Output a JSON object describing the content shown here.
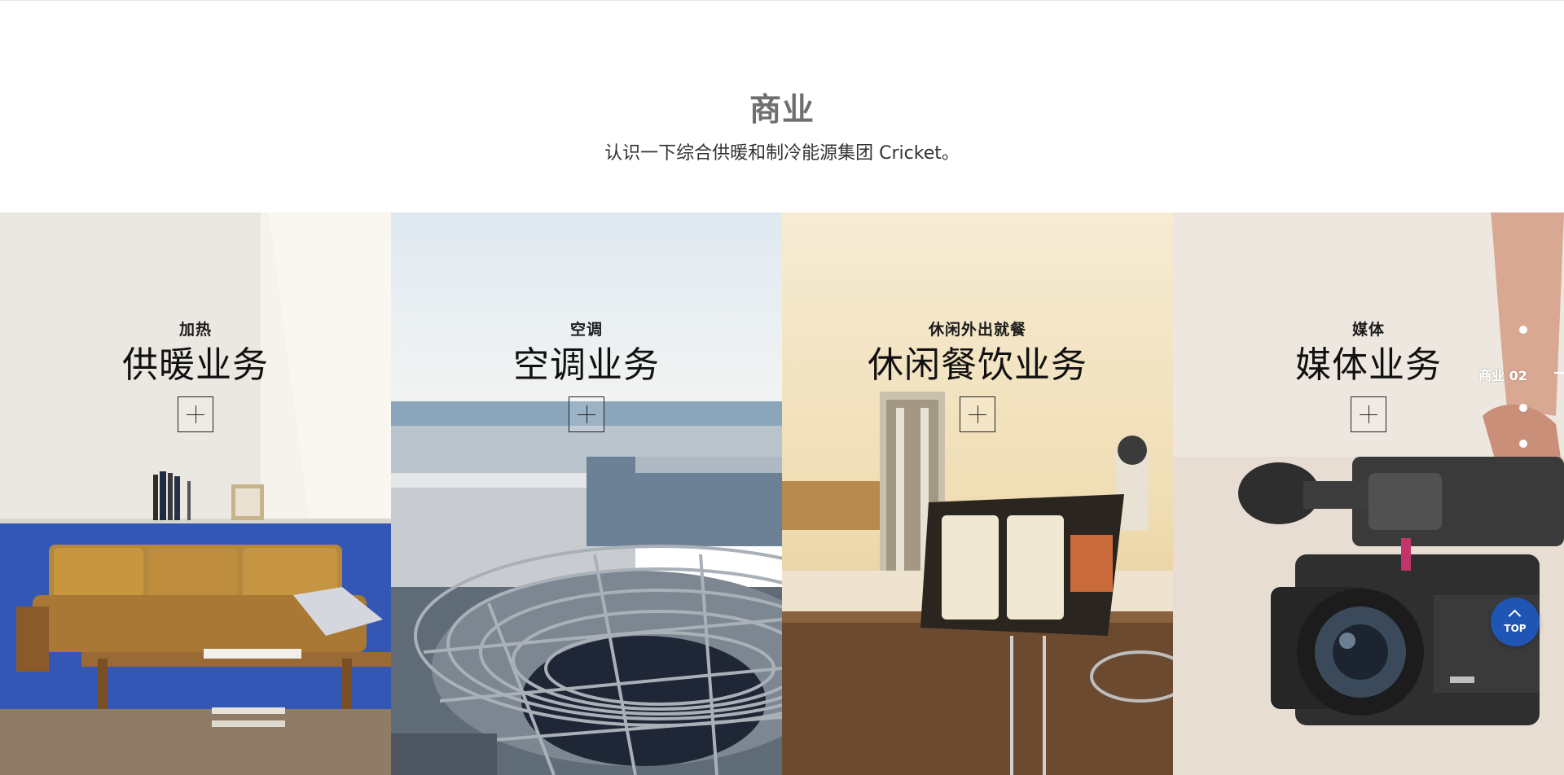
{
  "section": {
    "title": "商业",
    "subtitle": "认识一下综合供暖和制冷能源集团 Cricket。"
  },
  "cards": [
    {
      "sub": "加热",
      "title": "供暖业务"
    },
    {
      "sub": "空调",
      "title": "空调业务"
    },
    {
      "sub": "休闲外出就餐",
      "title": "休闲餐饮业务"
    },
    {
      "sub": "媒体",
      "title": "媒体业务"
    }
  ],
  "pager": {
    "label": "商业  02"
  },
  "top_button": {
    "label": "TOP"
  },
  "colors": {
    "title_gray": "#6f6f6f",
    "top_button_blue": "#1f56b5"
  }
}
